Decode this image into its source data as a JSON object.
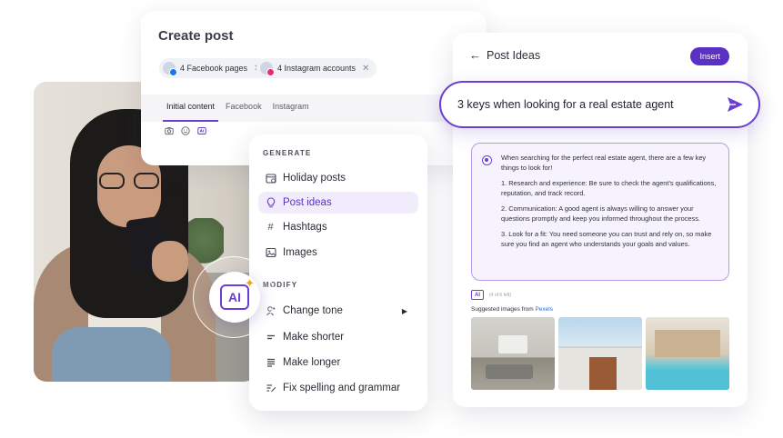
{
  "create_post": {
    "title": "Create post",
    "accounts": [
      {
        "label": "4 Facebook pages",
        "network": "facebook"
      },
      {
        "label": "4 Instagram accounts",
        "network": "instagram"
      }
    ],
    "tabs": [
      {
        "label": "Initial content",
        "active": true
      },
      {
        "label": "Facebook",
        "active": false
      },
      {
        "label": "Instagram",
        "active": false
      }
    ],
    "tools": [
      "camera-icon",
      "emoji-icon",
      "ai-assist-icon"
    ]
  },
  "menu": {
    "generate_label": "GENERATE",
    "generate_items": [
      {
        "label": "Holiday posts",
        "icon": "calendar-icon",
        "active": false
      },
      {
        "label": "Post ideas",
        "icon": "lightbulb-icon",
        "active": true
      },
      {
        "label": "Hashtags",
        "icon": "hashtag-icon",
        "active": false
      },
      {
        "label": "Images",
        "icon": "image-icon",
        "active": false
      }
    ],
    "modify_label": "MODIFY",
    "modify_items": [
      {
        "label": "Change tone",
        "icon": "tone-icon",
        "has_submenu": true
      },
      {
        "label": "Make shorter",
        "icon": "shorter-icon",
        "has_submenu": false
      },
      {
        "label": "Make longer",
        "icon": "longer-icon",
        "has_submenu": false
      },
      {
        "label": "Fix spelling and grammar",
        "icon": "spellcheck-icon",
        "has_submenu": false
      }
    ]
  },
  "ai_badge": {
    "label": "AI",
    "icon": "ai-sparkle-icon"
  },
  "ideas": {
    "title": "Post Ideas",
    "insert_label": "Insert",
    "prompt": "3 keys when looking for a real estate agent",
    "answer": [
      "When searching for the perfect real estate agent, there are a few key things to look for!",
      "1. Research and experience: Be sure to check the agent's qualifications, reputation, and track record.",
      "2. Communication: A good agent is always willing to answer your questions promptly and keep you informed throughout the process.",
      "3. Look for a fit: You need someone you can trust and rely on, so make sure you find an agent who understands your goals and values."
    ],
    "ai_tag": "AI",
    "ai_count": "(4 of 6 left)",
    "suggested_label": "Suggested images from ",
    "suggested_source": "Pexels",
    "images": [
      "living-room-photo",
      "modern-house-exterior-photo",
      "pool-patio-photo"
    ]
  },
  "colors": {
    "accent": "#6a3fd1",
    "insert_button": "#5b30c4",
    "answer_bg": "#f6f3fd",
    "link": "#1f6fe5"
  }
}
